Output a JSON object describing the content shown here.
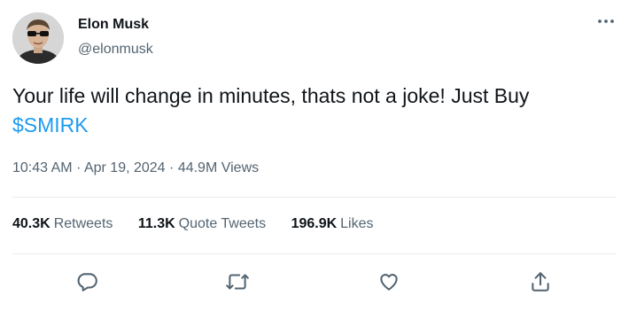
{
  "author": {
    "name": "Elon Musk",
    "handle": "@elonmusk",
    "avatar_icon": "profile-photo-avatar"
  },
  "tweet": {
    "text_before": "Your life will change in minutes, thats not a joke! Just Buy ",
    "cashtag": "$SMIRK",
    "time": "10:43 AM",
    "separator": "·",
    "date": "Apr 19, 2024",
    "views": "44.9M",
    "views_label": "Views"
  },
  "stats": [
    {
      "count": "40.3K",
      "label": "Retweets"
    },
    {
      "count": "11.3K",
      "label": "Quote Tweets"
    },
    {
      "count": "196.9K",
      "label": "Likes"
    }
  ],
  "actions": {
    "reply_icon": "reply-icon",
    "retweet_icon": "retweet-icon",
    "like_icon": "like-icon",
    "share_icon": "share-icon"
  },
  "more_icon": "more-options-icon",
  "colors": {
    "accent": "#1d9bf0",
    "text": "#0f1419",
    "secondary": "#536471",
    "divider": "#e6ecf0"
  }
}
